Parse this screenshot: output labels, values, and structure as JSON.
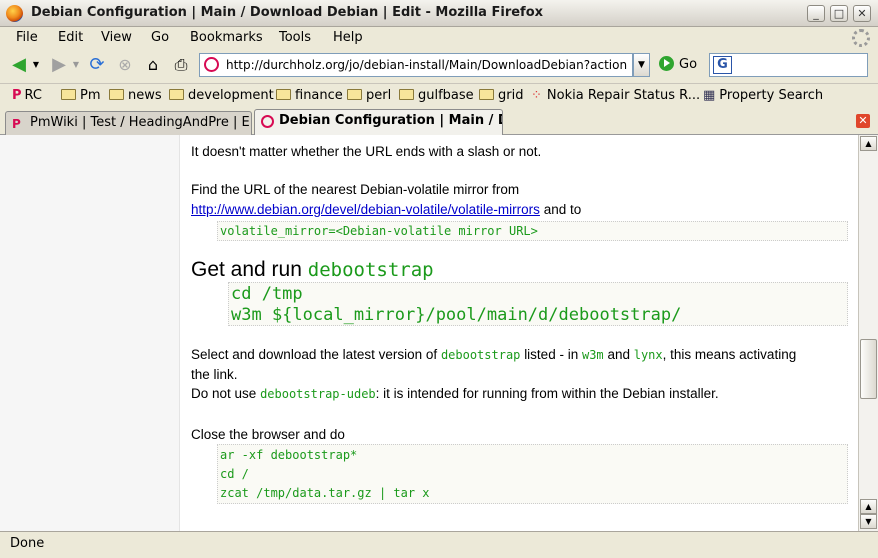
{
  "window": {
    "title": "Debian Configuration | Main / Download Debian | Edit - Mozilla Firefox",
    "buttons": {
      "minimize": "_",
      "maximize": "□",
      "close": "✕"
    }
  },
  "menu": {
    "items": [
      {
        "label": "File"
      },
      {
        "label": "Edit"
      },
      {
        "label": "View"
      },
      {
        "label": "Go"
      },
      {
        "label": "Bookmarks"
      },
      {
        "label": "Tools"
      },
      {
        "label": "Help"
      }
    ]
  },
  "toolbar": {
    "url": "http://durchholz.org/jo/debian-install/Main/DownloadDebian?action=",
    "go_label": "Go",
    "search_value": ""
  },
  "bookmarks": {
    "items": [
      {
        "label": "RC",
        "icon": "pmwiki-icon"
      },
      {
        "label": "Pm",
        "icon": "folder-icon"
      },
      {
        "label": "news",
        "icon": "folder-icon"
      },
      {
        "label": "development",
        "icon": "folder-icon"
      },
      {
        "label": "finance",
        "icon": "folder-icon"
      },
      {
        "label": "perl",
        "icon": "folder-icon"
      },
      {
        "label": "gulfbase",
        "icon": "folder-icon"
      },
      {
        "label": "grid",
        "icon": "folder-icon"
      },
      {
        "label": "Nokia Repair Status R...",
        "icon": "nokia-icon"
      },
      {
        "label": "Property Search",
        "icon": "property-icon"
      }
    ]
  },
  "tabs": [
    {
      "label": "PmWiki | Test / HeadingAndPre | E...",
      "active": false
    },
    {
      "label": "Debian Configuration | Main / D...",
      "active": true
    }
  ],
  "content": {
    "line1": "It doesn't matter whether the URL ends with a slash or not.",
    "para2_a": "Find the URL of the nearest Debian-volatile mirror from",
    "para2_link": "http://www.debian.org/devel/debian-volatile/volatile-mirrors",
    "para2_b": "and to",
    "pre1": "volatile_mirror=<Debian-volatile mirror URL>",
    "heading_text": "Get and run",
    "heading_code": "debootstrap",
    "pre2": [
      "cd /tmp",
      "w3m ${local_mirror}/pool/main/d/debootstrap/"
    ],
    "para3_a": "Select and download the latest version of",
    "para3_code1": "debootstrap",
    "para3_b": "listed - in",
    "para3_code2": "w3m",
    "para3_c": "and",
    "para3_code3": "lynx",
    "para3_d": ", this means activating",
    "para3_e": "the link.",
    "para4_a": "Do not use",
    "para4_code": "debootstrap-udeb",
    "para4_b": ": it is intended for running from within the Debian installer.",
    "para5": "Close the browser and do",
    "pre3": [
      "ar -xf debootstrap*",
      "cd /",
      "zcat /tmp/data.tar.gz | tar x"
    ]
  },
  "status": {
    "text": "Done"
  }
}
